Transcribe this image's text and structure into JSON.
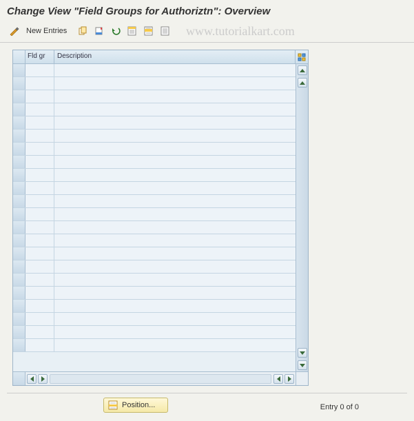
{
  "title": "Change View \"Field Groups for Authoriztn\": Overview",
  "toolbar": {
    "new_entries_label": "New Entries"
  },
  "watermark": "www.tutorialkart.com",
  "grid": {
    "columns": {
      "fldgr": "Fld gr",
      "description": "Description"
    },
    "row_count": 22
  },
  "footer": {
    "position_label": "Position...",
    "entry_text": "Entry 0 of 0"
  }
}
